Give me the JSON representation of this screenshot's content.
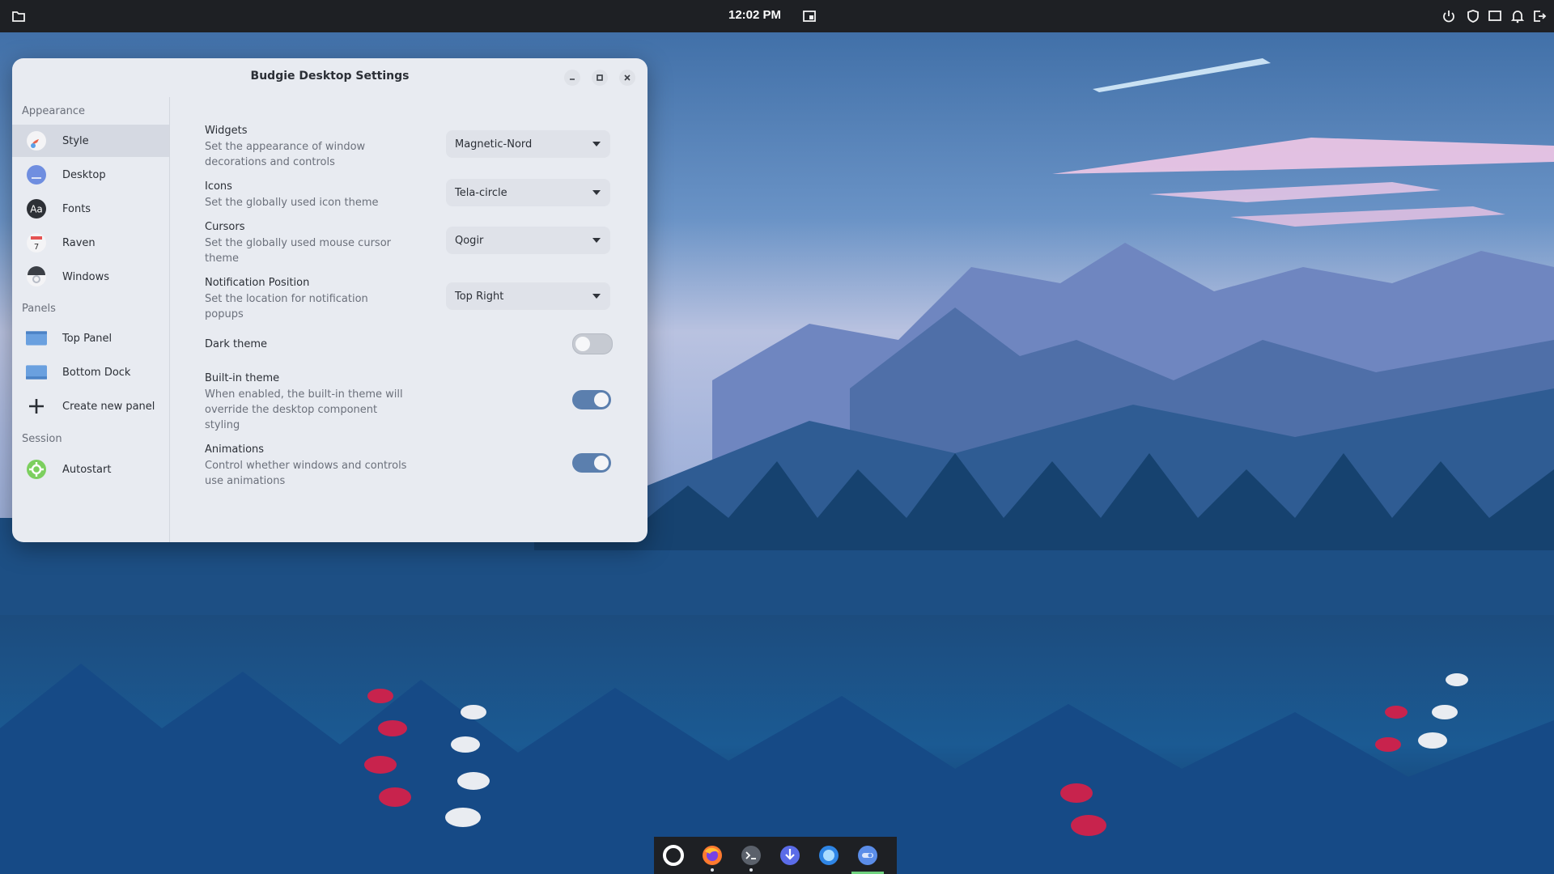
{
  "topbar": {
    "clock": "12:02 PM",
    "left_icon": "folder-icon",
    "right_icons": [
      "power-icon",
      "shield-icon",
      "display-icon",
      "bell-icon",
      "exit-icon"
    ]
  },
  "window": {
    "title": "Budgie Desktop Settings",
    "controls": [
      "minimize-icon",
      "maximize-icon",
      "close-icon"
    ]
  },
  "sidebar": {
    "sections": [
      {
        "label": "Appearance",
        "items": [
          {
            "label": "Style",
            "icon": "style-icon",
            "active": true
          },
          {
            "label": "Desktop",
            "icon": "desktop-icon"
          },
          {
            "label": "Fonts",
            "icon": "fonts-icon"
          },
          {
            "label": "Raven",
            "icon": "calendar-icon"
          },
          {
            "label": "Windows",
            "icon": "windows-gear-icon"
          }
        ]
      },
      {
        "label": "Panels",
        "items": [
          {
            "label": "Top Panel",
            "icon": "top-panel-icon"
          },
          {
            "label": "Bottom Dock",
            "icon": "bottom-dock-icon"
          },
          {
            "label": "Create new panel",
            "icon": "plus-icon"
          }
        ]
      },
      {
        "label": "Session",
        "items": [
          {
            "label": "Autostart",
            "icon": "autostart-gear-icon"
          }
        ]
      }
    ]
  },
  "settings": {
    "widgets": {
      "title": "Widgets",
      "desc": "Set the appearance of window decorations and controls",
      "value": "Magnetic-Nord"
    },
    "icons": {
      "title": "Icons",
      "desc": "Set the globally used icon theme",
      "value": "Tela-circle"
    },
    "cursors": {
      "title": "Cursors",
      "desc": "Set the globally used mouse cursor theme",
      "value": "Qogir"
    },
    "notification": {
      "title": "Notification Position",
      "desc": "Set the location for notification popups",
      "value": "Top Right"
    },
    "dark_theme": {
      "title": "Dark theme",
      "enabled": false
    },
    "builtin_theme": {
      "title": "Built-in theme",
      "desc": "When enabled, the built-in theme will override the desktop component styling",
      "enabled": true
    },
    "animations": {
      "title": "Animations",
      "desc": "Control whether windows and controls use animations",
      "enabled": true
    }
  },
  "dock": {
    "items": [
      "circle-launcher-icon",
      "firefox-icon",
      "terminal-icon",
      "downloader-icon",
      "browser-icon",
      "settings-toggle-icon"
    ]
  },
  "colors": {
    "accent": "#5b7fae",
    "panel": "#1e2024",
    "window_bg": "#e8ebf1"
  }
}
